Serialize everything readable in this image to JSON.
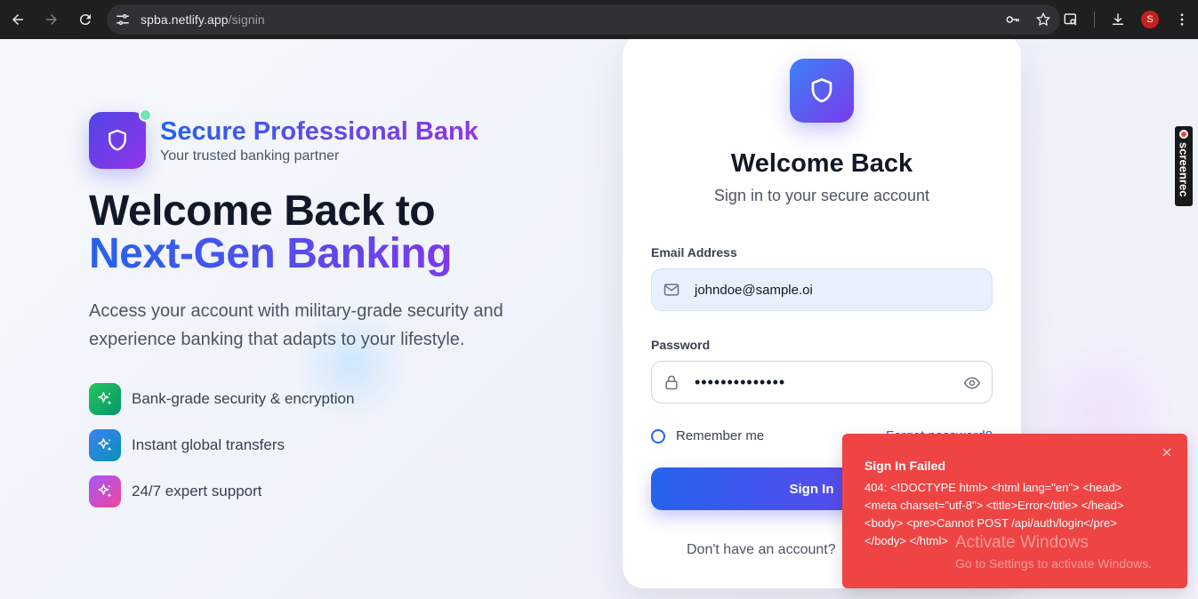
{
  "browser": {
    "url_host": "spba.netlify.app",
    "url_path": "/signin",
    "profile_initial": "S",
    "extension_label": "screenrec"
  },
  "brand": {
    "name": "Secure Professional Bank",
    "tagline": "Your trusted banking partner"
  },
  "hero": {
    "line1": "Welcome Back to",
    "line2": "Next-Gen Banking",
    "description": "Access your account with military-grade security and experience banking that adapts to your lifestyle."
  },
  "features": [
    {
      "label": "Bank-grade security & encryption",
      "icon": "sparkles-icon"
    },
    {
      "label": "Instant global transfers",
      "icon": "sparkles-icon"
    },
    {
      "label": "24/7 expert support",
      "icon": "sparkles-icon"
    }
  ],
  "signin_card": {
    "title": "Welcome Back",
    "subtitle": "Sign in to your secure account",
    "email_label": "Email Address",
    "email_value": "johndoe@sample.oi",
    "password_label": "Password",
    "password_masked": "••••••••••••••",
    "remember_label": "Remember me",
    "forgot_label": "Forgot password?",
    "submit_label": "Sign In",
    "submit_arrow": "→",
    "no_account_text": "Don't have an account?"
  },
  "toast": {
    "title": "Sign In Failed",
    "message": "404: <!DOCTYPE html> <html lang=\"en\"> <head> <meta charset=\"utf-8\"> <title>Error</title> </head> <body> <pre>Cannot POST /api/auth/login</pre> </body> </html>"
  },
  "watermark": {
    "line1": "Activate Windows",
    "line2": "Go to Settings to activate Windows."
  },
  "colors": {
    "primary": "#2563eb",
    "accent": "#7c3aed",
    "error": "#ef4444",
    "chrome_bg": "#1f1f1f"
  }
}
